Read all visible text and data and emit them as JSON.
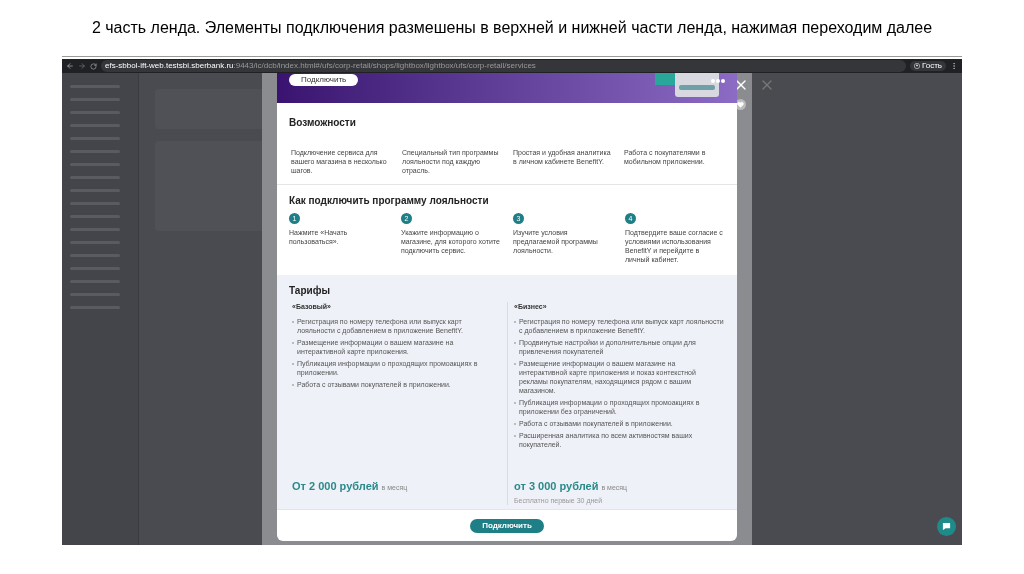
{
  "slide_title": "2 часть ленда. Элементы подключения размешены в верхней и нижней части ленда, нажимая переходим далее",
  "browser": {
    "url_host": "efs-sbbol-ift-web.testsbi.sberbank.ru",
    "url_path": ":9443/ic/dcb/index.html#/ufs/corp-retail/shops/lightbox/lightbox/ufs/corp-retail/services",
    "profile": "Гость"
  },
  "modal": {
    "banner_button": "Подключить",
    "features": {
      "title": "Возможности",
      "items": [
        "Подключение сервиса для вашего магазина в несколько шагов.",
        "Специальный тип программы лояльности под каждую отрасль.",
        "Простая и удобная аналитика в личном кабинете BenefitY.",
        "Работа с покупателями в мобильном приложении."
      ]
    },
    "steps": {
      "title": "Как подключить программу лояльности",
      "items": [
        {
          "number": "1",
          "text": "Нажмите «Начать пользоваться»."
        },
        {
          "number": "2",
          "text": "Укажите информацию о магазине, для которого хотите подключить сервис."
        },
        {
          "number": "3",
          "text": "Изучите условия предлагаемой программы лояльности."
        },
        {
          "number": "4",
          "text": "Подтвердите ваше согласие с условиями использования BenefitY и перейдите в личный кабинет."
        }
      ]
    },
    "tariffs": {
      "title": "Тарифы",
      "plans": [
        {
          "name": "«Базовый»",
          "features": [
            "Регистрация по номеру телефона или выпуск карт лояльности с добавлением в приложение BenefitY.",
            "Размещение информации о вашем магазине на интерактивной карте приложения.",
            "Публикация информации о проходящих промоакциях в приложении.",
            "Работа с отзывами покупателей в приложении."
          ],
          "price": "От 2 000 рублей",
          "period": "в месяц"
        },
        {
          "name": "«Бизнес»",
          "features": [
            "Регистрация по номеру телефона или выпуск карт лояльности с добавлением в приложение BenefitY.",
            "Продвинутые настройки и дополнительные опции для привлечения покупателей",
            "Размещение информации о вашем магазине на интерактивной карте приложения и показ контекстной рекламы покупателям, находящимся рядом с вашим магазином.",
            "Публикация информации о проходящих промоакциях в приложении без ограничений.",
            "Работа с отзывами покупателей в приложении.",
            "Расширенная аналитика по всем активностям ваших покупателей."
          ],
          "price": "от 3 000 рублей",
          "period": "в месяц",
          "note": "Бесплатно первые 30 дней"
        }
      ]
    },
    "footer_button": "Подключить"
  }
}
